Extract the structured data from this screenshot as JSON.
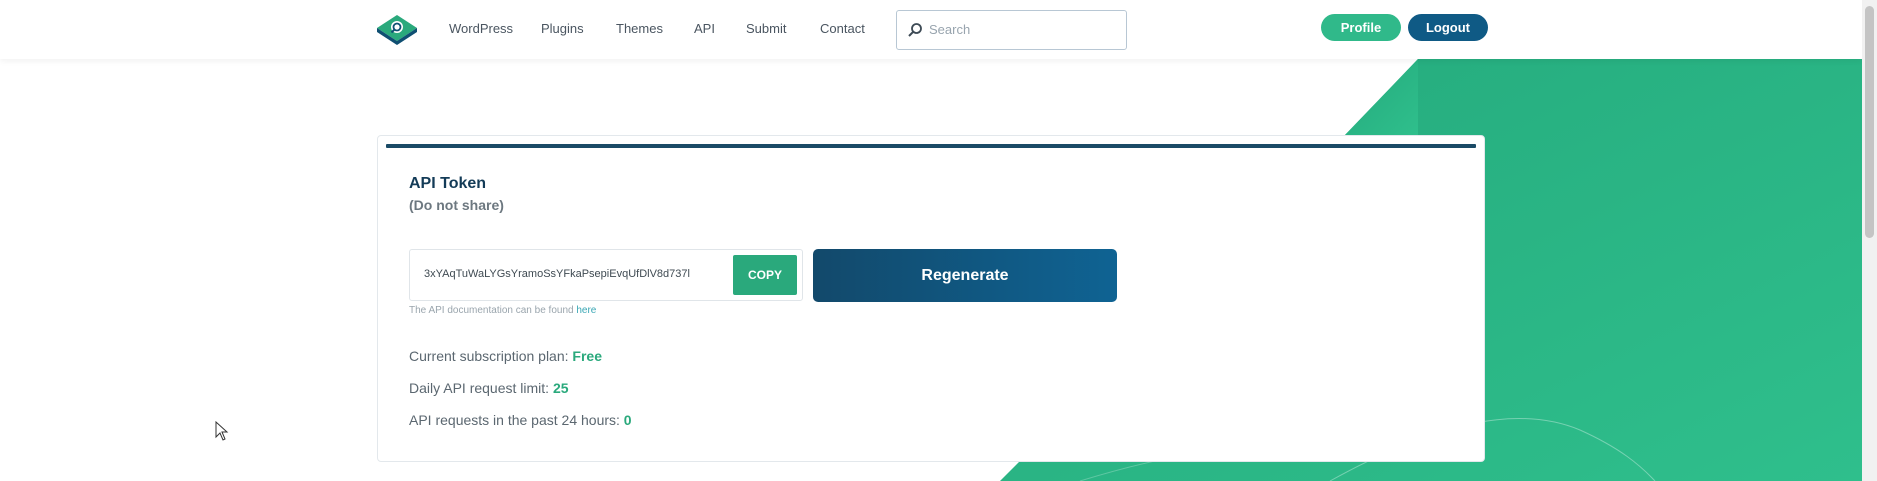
{
  "colors": {
    "green": "#30b98a",
    "navy": "#0f5a85",
    "dark_title": "#133b57"
  },
  "header": {
    "logo_icon": "search-diamond-logo",
    "nav": [
      {
        "label": "WordPress"
      },
      {
        "label": "Plugins"
      },
      {
        "label": "Themes"
      },
      {
        "label": "API"
      },
      {
        "label": "Submit"
      },
      {
        "label": "Contact"
      }
    ],
    "search": {
      "placeholder": "Search",
      "value": "",
      "icon": "search-icon"
    },
    "profile_label": "Profile",
    "logout_label": "Logout"
  },
  "card": {
    "title": "API Token",
    "subtitle": "(Do not share)",
    "token": "3xYAqTuWaLYGsYramoSsYFkaPsepiEvqUfDlV8d737l",
    "copy_label": "COPY",
    "regenerate_label": "Regenerate",
    "doc_note_text": "The API documentation can be found ",
    "doc_note_link": "here",
    "stats": [
      {
        "label": "Current subscription plan: ",
        "value": "Free"
      },
      {
        "label": "Daily API request limit: ",
        "value": "25"
      },
      {
        "label": "API requests in the past 24 hours: ",
        "value": "0"
      }
    ]
  }
}
